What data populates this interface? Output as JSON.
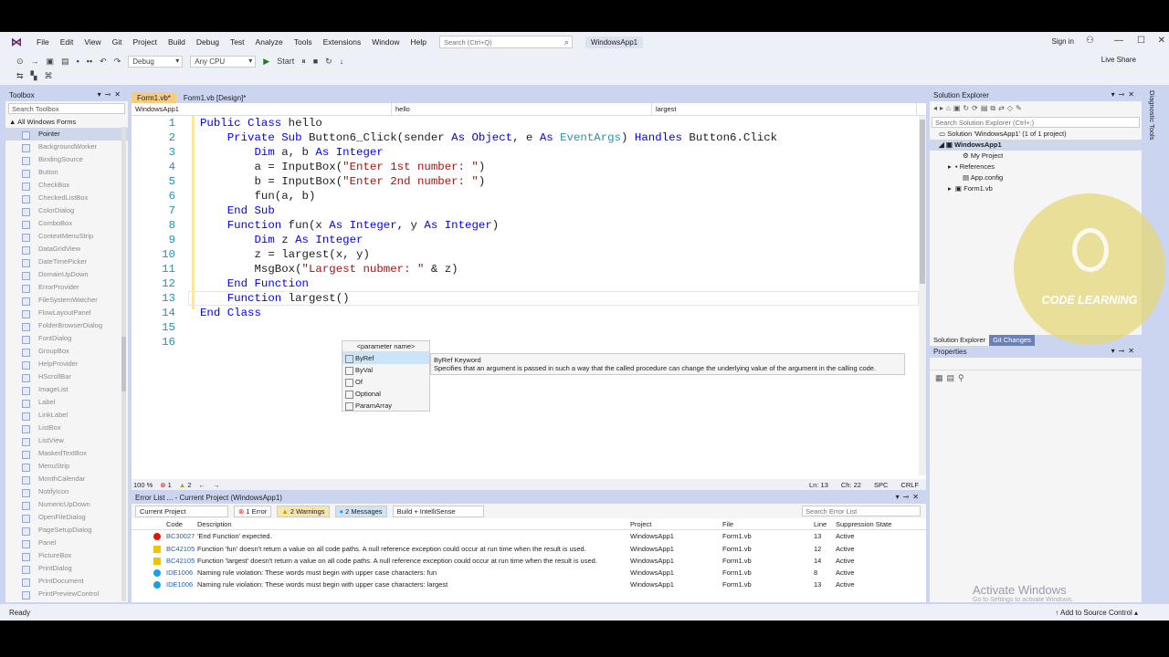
{
  "menu": {
    "items": [
      "File",
      "Edit",
      "View",
      "Git",
      "Project",
      "Build",
      "Debug",
      "Test",
      "Analyze",
      "Tools",
      "Extensions",
      "Window",
      "Help"
    ],
    "search_placeholder": "Search (Ctrl+Q)",
    "app_name": "WindowsApp1",
    "signin": "Sign in"
  },
  "toolbar": {
    "config": "Debug",
    "platform": "Any CPU",
    "start": "Start",
    "live_share": "Live Share"
  },
  "toolbox": {
    "title": "Toolbox",
    "search_placeholder": "Search Toolbox",
    "group": "All Windows Forms",
    "items": [
      "Pointer",
      "BackgroundWorker",
      "BindingSource",
      "Button",
      "CheckBox",
      "CheckedListBox",
      "ColorDialog",
      "ComboBox",
      "ContextMenuStrip",
      "DataGridView",
      "DateTimePicker",
      "DomainUpDown",
      "ErrorProvider",
      "FileSystemWatcher",
      "FlowLayoutPanel",
      "FolderBrowserDialog",
      "FontDialog",
      "GroupBox",
      "HelpProvider",
      "HScrollBar",
      "ImageList",
      "Label",
      "LinkLabel",
      "ListBox",
      "ListView",
      "MaskedTextBox",
      "MenuStrip",
      "MonthCalendar",
      "NotifyIcon",
      "NumericUpDown",
      "OpenFileDialog",
      "PageSetupDialog",
      "Panel",
      "PictureBox",
      "PrintDialog",
      "PrintDocument",
      "PrintPreviewControl"
    ]
  },
  "editor": {
    "tabs": [
      "Form1.vb*",
      "Form1.vb [Design]*"
    ],
    "nav": [
      "WindowsApp1",
      "hello",
      "largest"
    ],
    "line_numbers": [
      "1",
      "2",
      "3",
      "4",
      "5",
      "6",
      "7",
      "8",
      "9",
      "10",
      "11",
      "12",
      "13",
      "14",
      "15",
      "16"
    ],
    "intellisense_header": "<parameter name>",
    "intellisense_items": [
      "ByRef",
      "ByVal",
      "Of",
      "Optional",
      "ParamArray"
    ],
    "tooltip_title": "ByRef Keyword",
    "tooltip_desc": "Specifies that an argument is passed in such a way that the called procedure can change the underlying value of the argument in the calling code.",
    "zoom": "100 %",
    "errors_badge": "1",
    "warnings_badge": "2",
    "status_ln": "Ln: 13",
    "status_ch": "Ch: 22",
    "status_spc": "SPC",
    "status_crlf": "CRLF"
  },
  "error_list": {
    "title": "Error List ... - Current Project (WindowsApp1)",
    "scope": "Current Project",
    "errors": "1 Error",
    "warnings": "2 Warnings",
    "messages": "2 Messages",
    "build": "Build + IntelliSense",
    "search_placeholder": "Search Error List",
    "columns": [
      "Code",
      "Description",
      "Project",
      "File",
      "Line",
      "Suppression State"
    ],
    "rows": [
      {
        "severity": "error",
        "code": "BC30027",
        "desc": "'End Function' expected.",
        "project": "WindowsApp1",
        "file": "Form1.vb",
        "line": "13",
        "state": "Active"
      },
      {
        "severity": "warning",
        "code": "BC42105",
        "desc": "Function 'fun' doesn't return a value on all code paths. A null reference exception could occur at run time when the result is used.",
        "project": "WindowsApp1",
        "file": "Form1.vb",
        "line": "12",
        "state": "Active"
      },
      {
        "severity": "warning",
        "code": "BC42105",
        "desc": "Function 'largest' doesn't return a value on all code paths. A null reference exception could occur at run time when the result is used.",
        "project": "WindowsApp1",
        "file": "Form1.vb",
        "line": "14",
        "state": "Active"
      },
      {
        "severity": "info",
        "code": "IDE1006",
        "desc": "Naming rule violation: These words must begin with upper case characters: fun",
        "project": "WindowsApp1",
        "file": "Form1.vb",
        "line": "8",
        "state": "Active"
      },
      {
        "severity": "info",
        "code": "IDE1006",
        "desc": "Naming rule violation: These words must begin with upper case characters: largest",
        "project": "WindowsApp1",
        "file": "Form1.vb",
        "line": "13",
        "state": "Active"
      }
    ]
  },
  "solution_explorer": {
    "title": "Solution Explorer",
    "search_placeholder": "Search Solution Explorer (Ctrl+;)",
    "solution": "Solution 'WindowsApp1' (1 of 1 project)",
    "project": "WindowsApp1",
    "nodes": [
      "My Project",
      "References",
      "App.config",
      "Form1.vb"
    ],
    "tabs": [
      "Solution Explorer",
      "Git Changes"
    ]
  },
  "properties": {
    "title": "Properties"
  },
  "diagnostic": "Diagnostic Tools",
  "activate": {
    "title": "Activate Windows",
    "sub": "Go to Settings to activate Windows."
  },
  "watermark": "CODE LEARNING",
  "status": {
    "ready": "Ready",
    "source": "Add to Source Control"
  }
}
